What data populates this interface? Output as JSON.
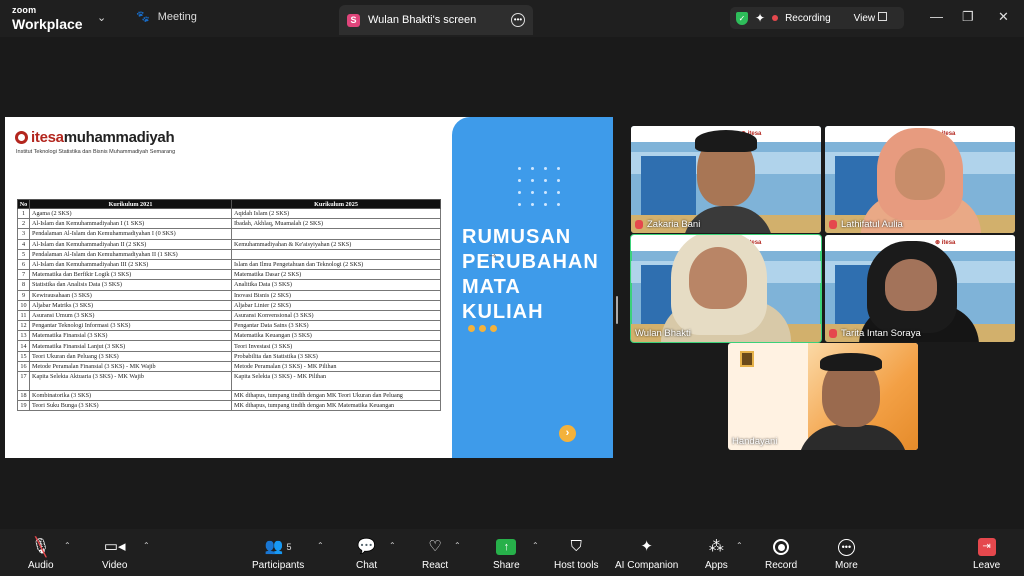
{
  "titlebar": {
    "brand_line1": "zoom",
    "brand_line2": "Workplace",
    "meeting_label": "Meeting",
    "share_tab_initial": "S",
    "share_tab_label": "Wulan Bhakti's screen",
    "recording_label": "Recording",
    "view_label": "View"
  },
  "slide": {
    "logo_red": "itesa",
    "logo_dark": "muhammadiyah",
    "institute": "Institut Teknologi Statistika dan Bisnis Muhammadiyah Semarang",
    "table_headers": [
      "No",
      "Kurikulum 2021",
      "Kurikulum 2025"
    ],
    "rows": [
      [
        "1",
        "Agama (2 SKS)",
        "Aqidah Islam (2 SKS)"
      ],
      [
        "2",
        "Al-Islam dan Kemuhammadiyahan I (1 SKS)",
        "Ibadah, Akhlaq, Muamalah (2 SKS)"
      ],
      [
        "3",
        "Pendalaman Al-Islam dan Kemuhammadiyahan I (0 SKS)",
        ""
      ],
      [
        "4",
        "Al-Islam dan Kemuhammadiyahan II (2 SKS)",
        "Kemuhammadiyahan & Ke'aisyiyahan (2 SKS)"
      ],
      [
        "5",
        "Pendalaman Al-Islam dan Kemuhammadiyahan II (1 SKS)",
        ""
      ],
      [
        "6",
        "Al-Islam dan Kemuhammadiyahan III (2 SKS)",
        "Islam dan Ilmu Pengetahuan dan Teknologi (2 SKS)"
      ],
      [
        "7",
        "Matematika dan Berfikir Logik (3 SKS)",
        "Matematika Dasar (2 SKS)"
      ],
      [
        "8",
        "Statistika dan Analisis Data (3 SKS)",
        "Analitika Data (3 SKS)"
      ],
      [
        "9",
        "Kewirausahaan (3 SKS)",
        "Inovasi Bisnis (2 SKS)"
      ],
      [
        "10",
        "Aljabar Matriks (3 SKS)",
        "Aljabar Linier (2 SKS)"
      ],
      [
        "11",
        "Asuransi Umum (3 SKS)",
        "Asuransi Konvensional (3 SKS)"
      ],
      [
        "12",
        "Pengantar Teknologi Informasi (3 SKS)",
        "Pengantar Data Sains (3 SKS)"
      ],
      [
        "13",
        "Matematika Finansial (3 SKS)",
        "Matematika Keuangan (3 SKS)"
      ],
      [
        "14",
        "Matematika Finansial Lanjut (3 SKS)",
        "Teori Investasi (3 SKS)"
      ],
      [
        "15",
        "Teori Ukuran dan Peluang (3 SKS)",
        "Probabilita dan Statistika (3 SKS)"
      ],
      [
        "16",
        "Metode Peramalan Finansial (3 SKS) - MK Wajib",
        "Metode Peramalan (3 SKS) - MK Pilihan"
      ],
      [
        "17",
        "Kapita Selekta Aktuaria (3 SKS) - MK Wajib",
        "Kapita Selekta (3 SKS) - MK Pilihan"
      ],
      [
        "18",
        "Kombinatorika (3 SKS)",
        "MK dihapus, tumpang tindih dengan MK Teori Ukuran dan Peluang"
      ],
      [
        "19",
        "Teori Suku Bunga (3 SKS)",
        "MK dihapus, tumpang tindih dengan MK Matematika Keuangan"
      ]
    ],
    "title_lines": [
      "RUMUSAN",
      "PERUBAHAN",
      "MATA",
      "KULIAH"
    ],
    "next_glyph": "›"
  },
  "participants": [
    {
      "name": "Zakaria Bani",
      "muted": true
    },
    {
      "name": "Lathifatul Aulia",
      "muted": true
    },
    {
      "name": "Wulan Bhakti",
      "muted": false,
      "active": true
    },
    {
      "name": "Tarita Intan Soraya",
      "muted": true
    },
    {
      "name": "Handayani",
      "muted": false
    }
  ],
  "toolbar": {
    "audio": "Audio",
    "video": "Video",
    "participants": "Participants",
    "participants_count": "5",
    "chat": "Chat",
    "react": "React",
    "share": "Share",
    "host_tools": "Host tools",
    "ai_companion": "AI Companion",
    "apps": "Apps",
    "record": "Record",
    "more": "More",
    "leave": "Leave"
  },
  "colors": {
    "accent_green": "#27b04a",
    "active_speaker": "#3bd17a",
    "slide_blue": "#3e9bea",
    "recording_red": "#e5484d",
    "slide_orange": "#f3b23c"
  }
}
